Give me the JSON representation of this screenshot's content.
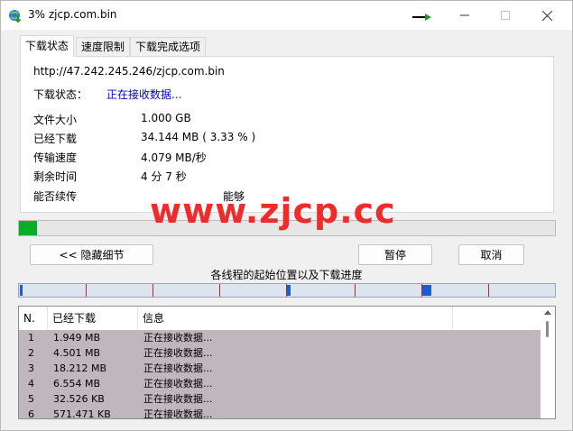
{
  "window": {
    "title": "3% zjcp.com.bin"
  },
  "tabs": [
    {
      "label": "下载状态"
    },
    {
      "label": "速度限制"
    },
    {
      "label": "下载完成选项"
    }
  ],
  "status": {
    "url": "http://47.242.245.246/zjcp.com.bin",
    "download_status_label": "下载状态：",
    "download_status_value": "正在接收数据...",
    "file_size_label": "文件大小",
    "file_size_value": "1.000  GB",
    "downloaded_label": "已经下载",
    "downloaded_value": "34.144  MB  ( 3.33 % )",
    "speed_label": "传输速度",
    "speed_value": "4.079  MB/秒",
    "remaining_label": "剩余时间",
    "remaining_value": "4 分 7 秒",
    "resume_label": "能否续传",
    "resume_value": "能够"
  },
  "progress": {
    "percent": 3.33
  },
  "watermark": "www.zjcp.cc",
  "buttons": {
    "hide_details": "<< 隐藏细节",
    "pause": "暂停",
    "cancel": "取消"
  },
  "threads_caption": "各线程的起始位置以及下载进度",
  "list": {
    "columns": [
      "N.",
      "已经下载",
      "信息"
    ],
    "rows": [
      {
        "n": "1",
        "downloaded": "1.949  MB",
        "info": "正在接收数据..."
      },
      {
        "n": "2",
        "downloaded": "4.501  MB",
        "info": "正在接收数据..."
      },
      {
        "n": "3",
        "downloaded": "18.212  MB",
        "info": "正在接收数据..."
      },
      {
        "n": "4",
        "downloaded": "6.554  MB",
        "info": "正在接收数据..."
      },
      {
        "n": "5",
        "downloaded": "32.526  KB",
        "info": "正在接收数据..."
      },
      {
        "n": "6",
        "downloaded": "571.471  KB",
        "info": "正在接收数据..."
      }
    ]
  },
  "colors": {
    "progress_fill": "#06b025",
    "status_value": "#0000cc",
    "watermark": "#f02b2b",
    "row_background": "#bfb6be",
    "segment_tick": "#c8232c",
    "segment_chunk": "#1a5fcf"
  }
}
